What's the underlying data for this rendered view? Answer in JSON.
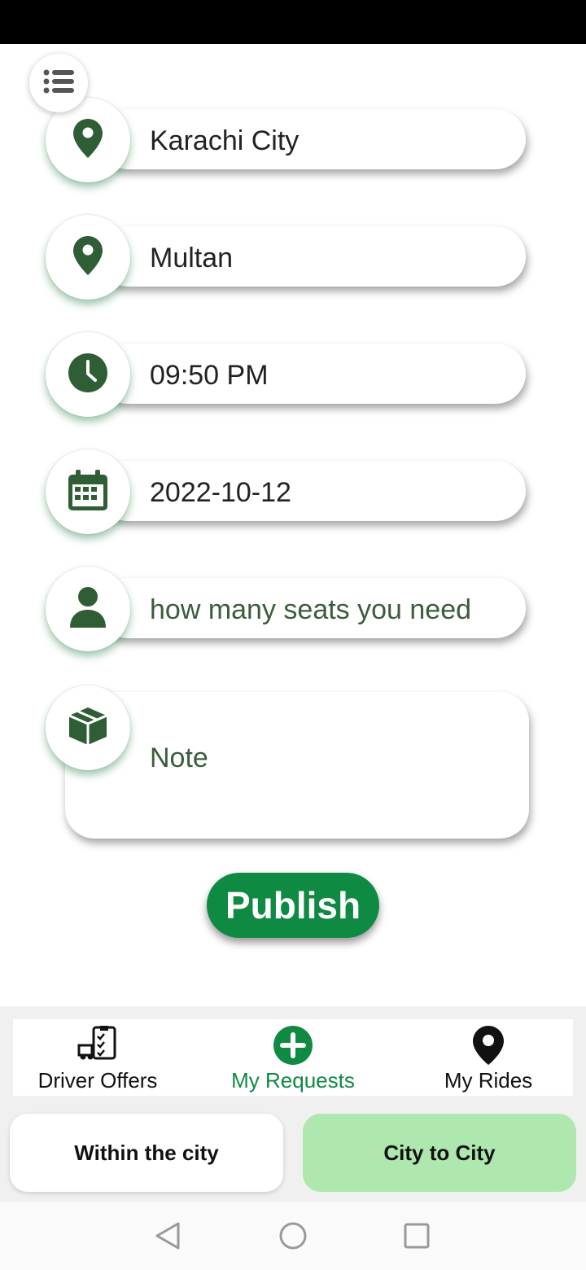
{
  "form": {
    "from": {
      "value": "Karachi City",
      "icon": "location-pin-icon"
    },
    "to": {
      "value": "Multan",
      "icon": "location-pin-icon"
    },
    "time": {
      "value": "09:50 PM",
      "icon": "clock-icon"
    },
    "date": {
      "value": "2022-10-12",
      "icon": "calendar-icon"
    },
    "seats": {
      "placeholder": "how many seats you need",
      "icon": "person-icon"
    },
    "note": {
      "placeholder": "Note",
      "icon": "package-icon"
    }
  },
  "publish_label": "Publish",
  "bottom_nav": [
    {
      "label": "Driver Offers",
      "icon": "offers-icon",
      "active": false
    },
    {
      "label": "My Requests",
      "icon": "plus-circle-icon",
      "active": true
    },
    {
      "label": "My Rides",
      "icon": "map-pin-icon",
      "active": false
    }
  ],
  "modes": [
    {
      "label": "Within the city",
      "selected": false
    },
    {
      "label": "City to City",
      "selected": true
    }
  ],
  "colors": {
    "brand_green": "#0f8a42",
    "icon_green": "#2f5e35",
    "selected_mode": "#aee8ae"
  }
}
